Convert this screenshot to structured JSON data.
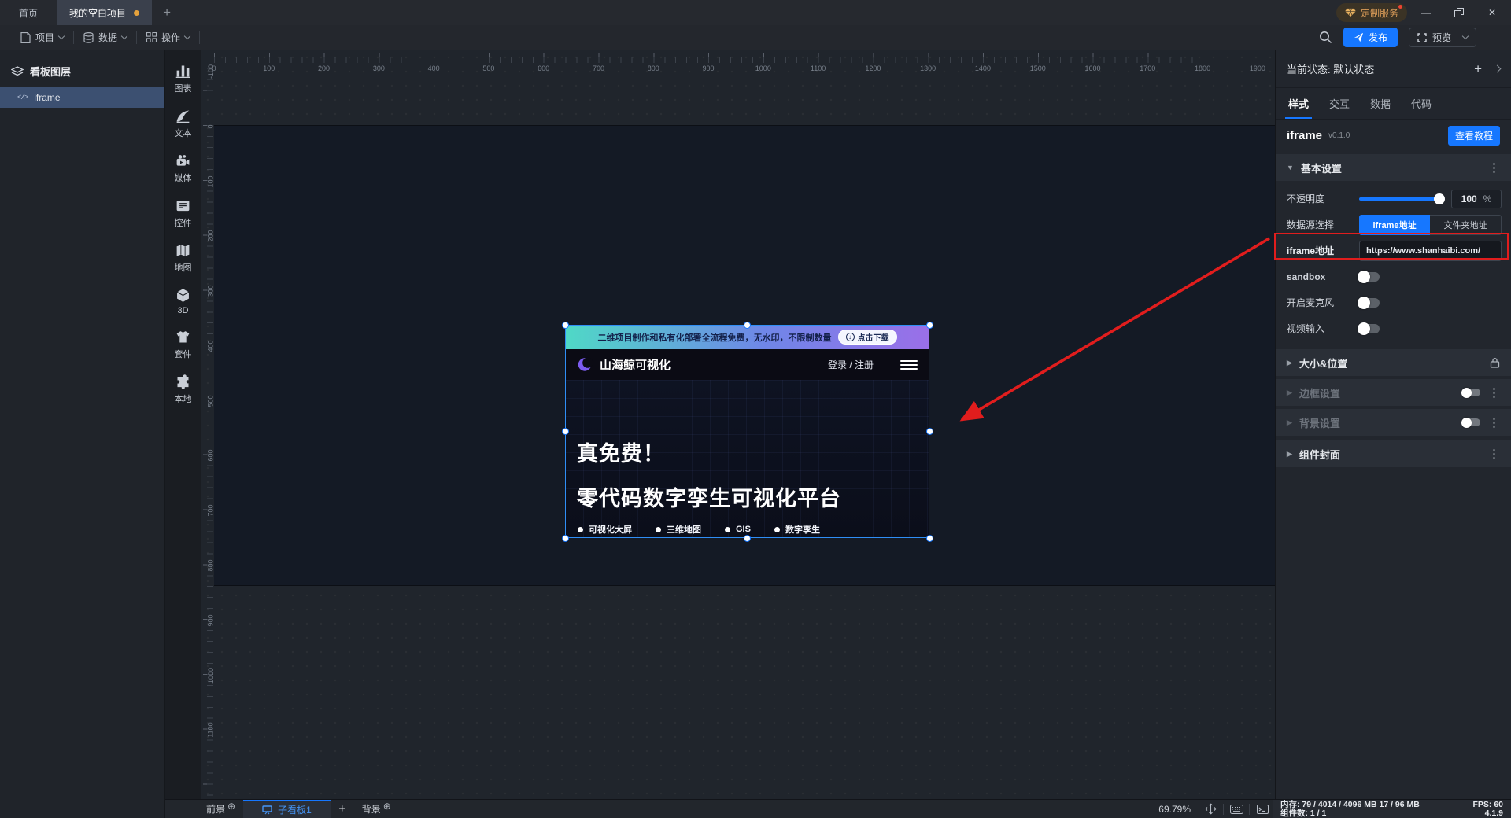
{
  "colors": {
    "accent": "#1677ff",
    "annotation_red": "#e11d1d",
    "unsaved_dot_orange": "#e6a23c",
    "selected_layer_blue": "#3c5071"
  },
  "titlebar": {
    "tabs": [
      {
        "label": "首页",
        "active": false,
        "modified": false
      },
      {
        "label": "我的空白项目",
        "active": true,
        "modified": true
      }
    ],
    "new_tab_label": "+",
    "custom_service_label": "定制服务",
    "minimize_label": "—",
    "close_label": "✕"
  },
  "menubar": {
    "menus": [
      {
        "icon": "project-icon",
        "label": "项目"
      },
      {
        "icon": "data-icon",
        "label": "数据"
      },
      {
        "icon": "operations-icon",
        "label": "操作"
      }
    ],
    "publish_label": "发布",
    "preview_label": "预览"
  },
  "layers_panel": {
    "title": "看板图层",
    "items": [
      {
        "icon": "code-icon",
        "label": "iframe",
        "selected": true
      }
    ]
  },
  "toolbox": {
    "items": [
      {
        "icon": "chart-icon",
        "label": "图表"
      },
      {
        "icon": "text-icon",
        "label": "文本"
      },
      {
        "icon": "media-icon",
        "label": "媒体"
      },
      {
        "icon": "widget-icon",
        "label": "控件"
      },
      {
        "icon": "map-icon",
        "label": "地图"
      },
      {
        "icon": "cube-3d-icon",
        "label": "3D"
      },
      {
        "icon": "kit-icon",
        "label": "套件"
      },
      {
        "icon": "local-icon",
        "label": "本地"
      }
    ]
  },
  "canvas": {
    "h_ruler": [
      0,
      100,
      200,
      300,
      400,
      500,
      600,
      700,
      800,
      900,
      1000,
      1100,
      1200,
      1300,
      1400,
      1500,
      1600,
      1700,
      1800,
      1900
    ],
    "v_ruler": [
      -100,
      0,
      100,
      200,
      300,
      400,
      500,
      600,
      700,
      800,
      900,
      1000,
      1100
    ]
  },
  "iframe_preview": {
    "banner_text": "二维项目制作和私有化部署全流程免费，无水印，不限制数量",
    "banner_button": "点击下载",
    "download_arrow": "↓",
    "brand": "山海鲸可视化",
    "auth": "登录 / 注册",
    "headline1": "真免费！",
    "headline2": "零代码数字孪生可视化平台",
    "bullets": [
      "可视化大屏",
      "三维地图",
      "GIS",
      "数字孪生"
    ]
  },
  "inspector": {
    "state_label": "当前状态: 默认状态",
    "add_state_label": "+",
    "tabs": [
      {
        "label": "样式",
        "active": true
      },
      {
        "label": "交互",
        "active": false
      },
      {
        "label": "数据",
        "active": false
      },
      {
        "label": "代码",
        "active": false
      }
    ],
    "component": {
      "name": "iframe",
      "version": "v0.1.0",
      "tutorial_button": "查看教程"
    },
    "basic_section": {
      "title": "基本设置",
      "opacity": {
        "label": "不透明度",
        "value": "100",
        "unit": "%"
      },
      "datasource": {
        "label": "数据源选择",
        "options": [
          {
            "label": "iframe地址",
            "active": true
          },
          {
            "label": "文件夹地址",
            "active": false
          }
        ]
      },
      "iframe_url": {
        "label": "iframe地址",
        "value": "https://www.shanhaibi.com/"
      },
      "toggles": [
        {
          "label": "sandbox",
          "on": false
        },
        {
          "label": "开启麦克风",
          "on": false
        },
        {
          "label": "视频输入",
          "on": false
        }
      ]
    },
    "sections": [
      {
        "label": "大小&位置"
      },
      {
        "label": "边框设置"
      },
      {
        "label": "背景设置"
      },
      {
        "label": "组件封面"
      }
    ]
  },
  "statusbar": {
    "foreground_label": "前景",
    "active_board_label": "子看板1",
    "add_board_label": "+",
    "background_label": "背景",
    "zoom_level": "69.79%",
    "memory_label": "内存:",
    "memory_value": "79 / 4014 / 4096 MB  17 / 96 MB",
    "fps_label": "FPS:",
    "fps_value": "60",
    "components_label": "组件数:",
    "components_value": "1 / 1",
    "app_version": "4.1.9"
  }
}
